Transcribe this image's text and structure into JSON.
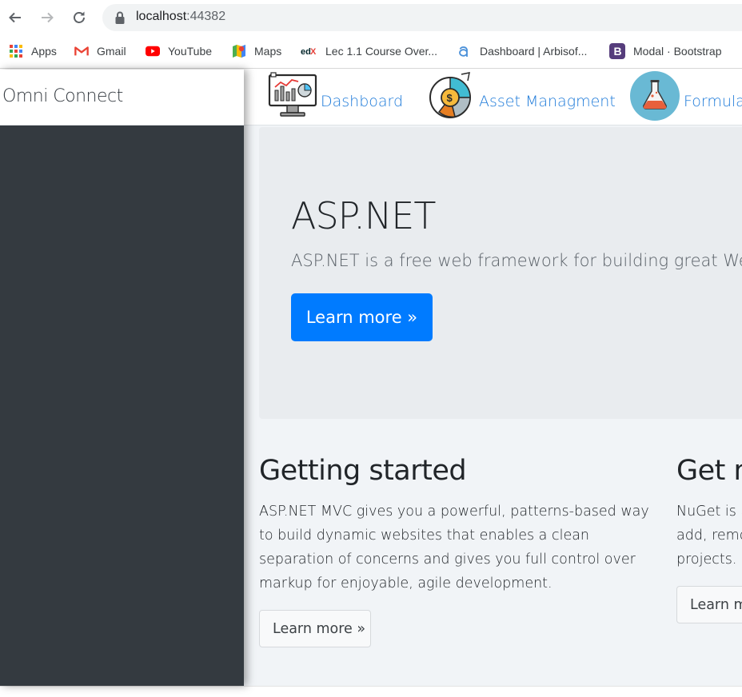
{
  "browser": {
    "url_host": "localhost",
    "url_port": ":44382",
    "bookmarks": [
      {
        "label": "Apps",
        "icon": "apps-grid-icon"
      },
      {
        "label": "Gmail",
        "icon": "gmail-icon"
      },
      {
        "label": "YouTube",
        "icon": "youtube-icon"
      },
      {
        "label": "Maps",
        "icon": "maps-icon"
      },
      {
        "label": "Lec 1.1 Course Over...",
        "icon": "edx-icon"
      },
      {
        "label": "Dashboard | Arbisof...",
        "icon": "arbisoft-icon"
      },
      {
        "label": "Modal · Bootstrap",
        "icon": "bootstrap-icon"
      }
    ]
  },
  "sidebar": {
    "brand": "Omni Connect"
  },
  "topnav": {
    "items": [
      {
        "label": "Dashboard",
        "icon": "dashboard-monitor-icon"
      },
      {
        "label": "Asset Managment",
        "icon": "asset-pie-chart-icon"
      },
      {
        "label": "Formula",
        "icon": "formula-flask-icon"
      }
    ]
  },
  "jumbotron": {
    "title": "ASP.NET",
    "lead": "ASP.NET is a free web framework for building great Web s",
    "button": "Learn more »"
  },
  "columns": [
    {
      "title": "Getting started",
      "text": "ASP.NET MVC gives you a powerful, patterns-based way to build dynamic websites that enables a clean separation of concerns and gives you full control over markup for enjoyable, agile development.",
      "button": "Learn more »"
    },
    {
      "title": "Get m",
      "text_lines": [
        "NuGet is a",
        "add, remo",
        "projects."
      ],
      "button": "Learn m"
    }
  ],
  "colors": {
    "sidebar": "#343a40",
    "primary": "#007bff",
    "nav_link": "#1d7ad9",
    "jumbotron": "#e9ecef",
    "main_bg": "#f1f4f7"
  }
}
